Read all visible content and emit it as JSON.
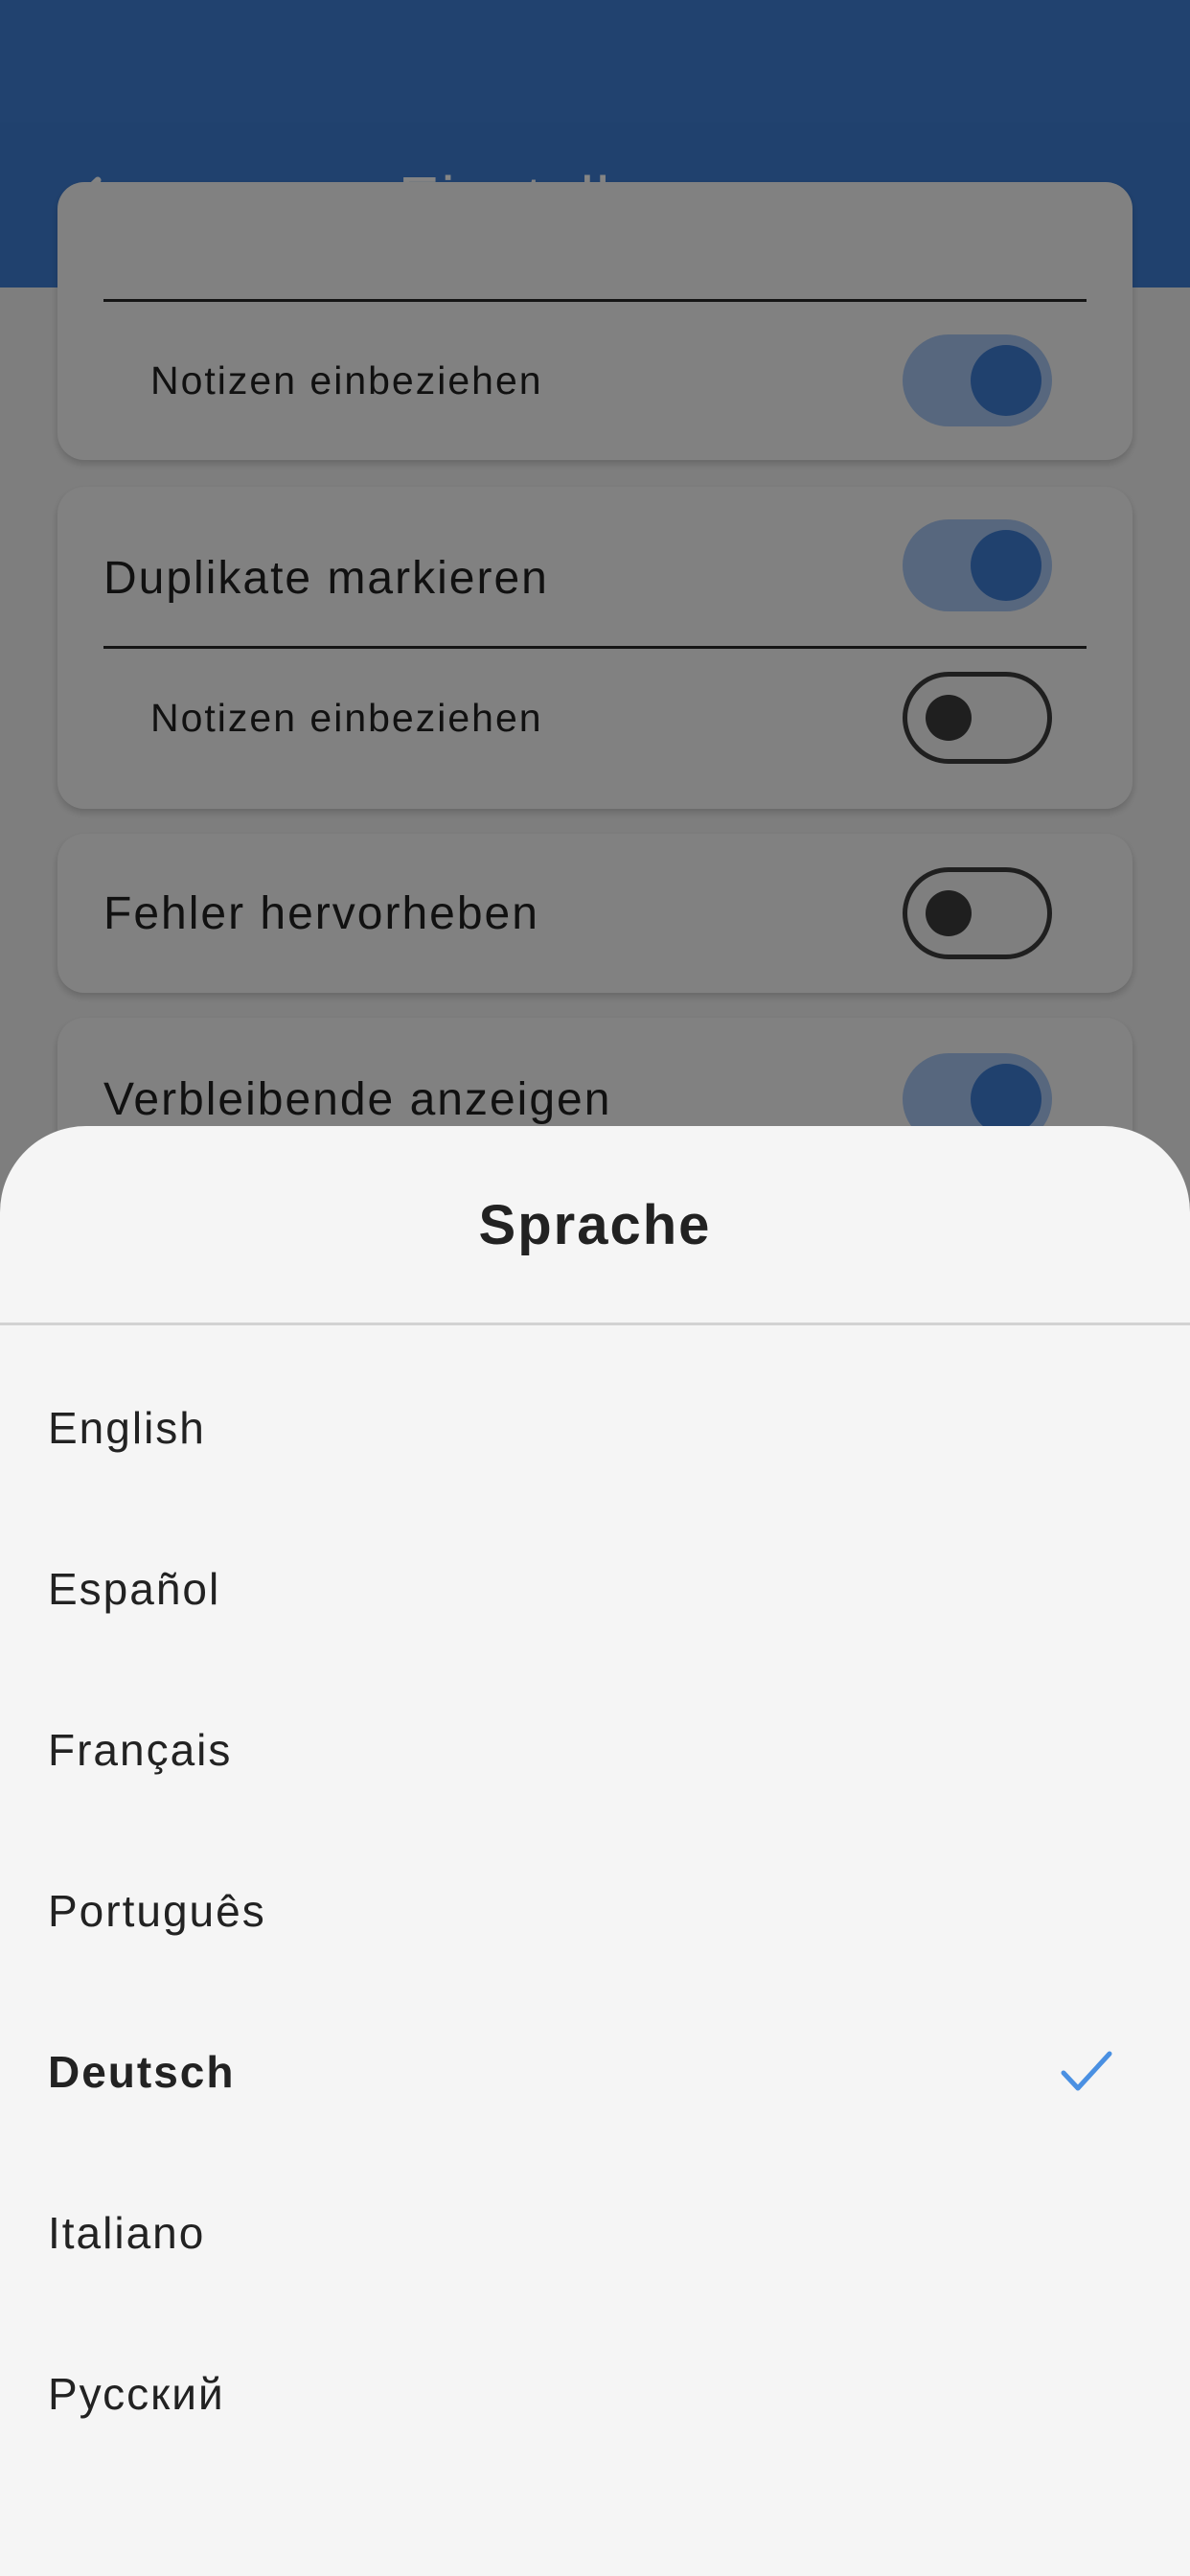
{
  "header": {
    "title": "Einstellungen"
  },
  "settings": {
    "card1": {
      "sub_label": "Notizen einbeziehen",
      "sub_on": true
    },
    "card2": {
      "label": "Duplikate markieren",
      "on": true,
      "sub_label": "Notizen einbeziehen",
      "sub_on": false
    },
    "card3": {
      "label": "Fehler hervorheben",
      "on": false
    },
    "card4": {
      "label": "Verbleibende anzeigen",
      "on": true
    }
  },
  "sheet": {
    "title": "Sprache",
    "languages": [
      {
        "label": "English",
        "selected": false
      },
      {
        "label": "Español",
        "selected": false
      },
      {
        "label": "Français",
        "selected": false
      },
      {
        "label": "Português",
        "selected": false
      },
      {
        "label": "Deutsch",
        "selected": true
      },
      {
        "label": "Italiano",
        "selected": false
      },
      {
        "label": "Русский",
        "selected": false
      }
    ]
  },
  "colors": {
    "primary": "#3f7ed4",
    "check": "#4a90e2",
    "sheet_background": "#f5f5f5"
  },
  "icons": {
    "back": "chevron-left-icon",
    "selected": "checkmark-icon"
  }
}
